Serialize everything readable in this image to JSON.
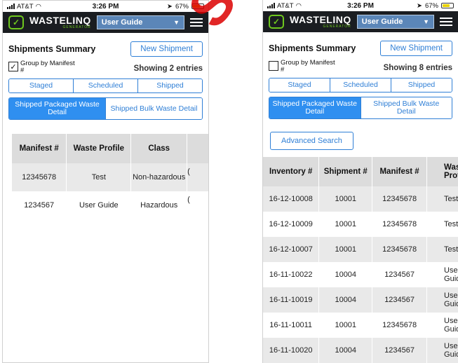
{
  "watermark": "SEP",
  "left": {
    "status": {
      "carrier": "AT&T",
      "time": "3:26 PM",
      "battery": "67%",
      "battery_level": 0.67
    },
    "app": {
      "brand": "WASTELINQ",
      "brand_sub": "GENERATOR",
      "guide_select": "User Guide"
    },
    "summary_title": "Shipments Summary",
    "new_shipment": "New Shipment",
    "group_by": "Group by Manifest #",
    "group_checked": true,
    "showing": "Showing 2 entries",
    "tabs": [
      "Staged",
      "Scheduled",
      "Shipped"
    ],
    "detail_tabs": [
      "Shipped Packaged Waste Detail",
      "Shipped Bulk Waste Detail"
    ],
    "table": {
      "headers": [
        "Manifest #",
        "Waste Profile",
        "Class",
        ""
      ],
      "rows": [
        [
          "12345678",
          "Test",
          "Non-hazardous",
          "("
        ],
        [
          "1234567",
          "User Guide",
          "Hazardous",
          "("
        ]
      ]
    }
  },
  "right": {
    "status": {
      "carrier": "AT&T",
      "time": "3:26 PM",
      "battery": "67%",
      "battery_level": 0.67
    },
    "app": {
      "brand": "WASTELINQ",
      "brand_sub": "GENERATOR",
      "guide_select": "User Guide"
    },
    "summary_title": "Shipments Summary",
    "new_shipment": "New Shipment",
    "group_by": "Group by Manifest #",
    "group_checked": false,
    "showing": "Showing 8 entries",
    "tabs": [
      "Staged",
      "Scheduled",
      "Shipped"
    ],
    "detail_tabs": [
      "Shipped Packaged Waste Detail",
      "Shipped Bulk Waste Detail"
    ],
    "advanced_search": "Advanced Search",
    "table": {
      "headers": [
        "Inventory #",
        "Shipment #",
        "Manifest #",
        "Waste Profile"
      ],
      "rows": [
        [
          "16-12-10008",
          "10001",
          "12345678",
          "Test"
        ],
        [
          "16-12-10009",
          "10001",
          "12345678",
          "Test"
        ],
        [
          "16-12-10007",
          "10001",
          "12345678",
          "Test"
        ],
        [
          "16-11-10022",
          "10004",
          "1234567",
          "User Guide"
        ],
        [
          "16-11-10019",
          "10004",
          "1234567",
          "User Guide"
        ],
        [
          "16-11-10011",
          "10001",
          "12345678",
          "User Guide"
        ],
        [
          "16-11-10020",
          "10004",
          "1234567",
          "User Guide"
        ]
      ]
    }
  }
}
